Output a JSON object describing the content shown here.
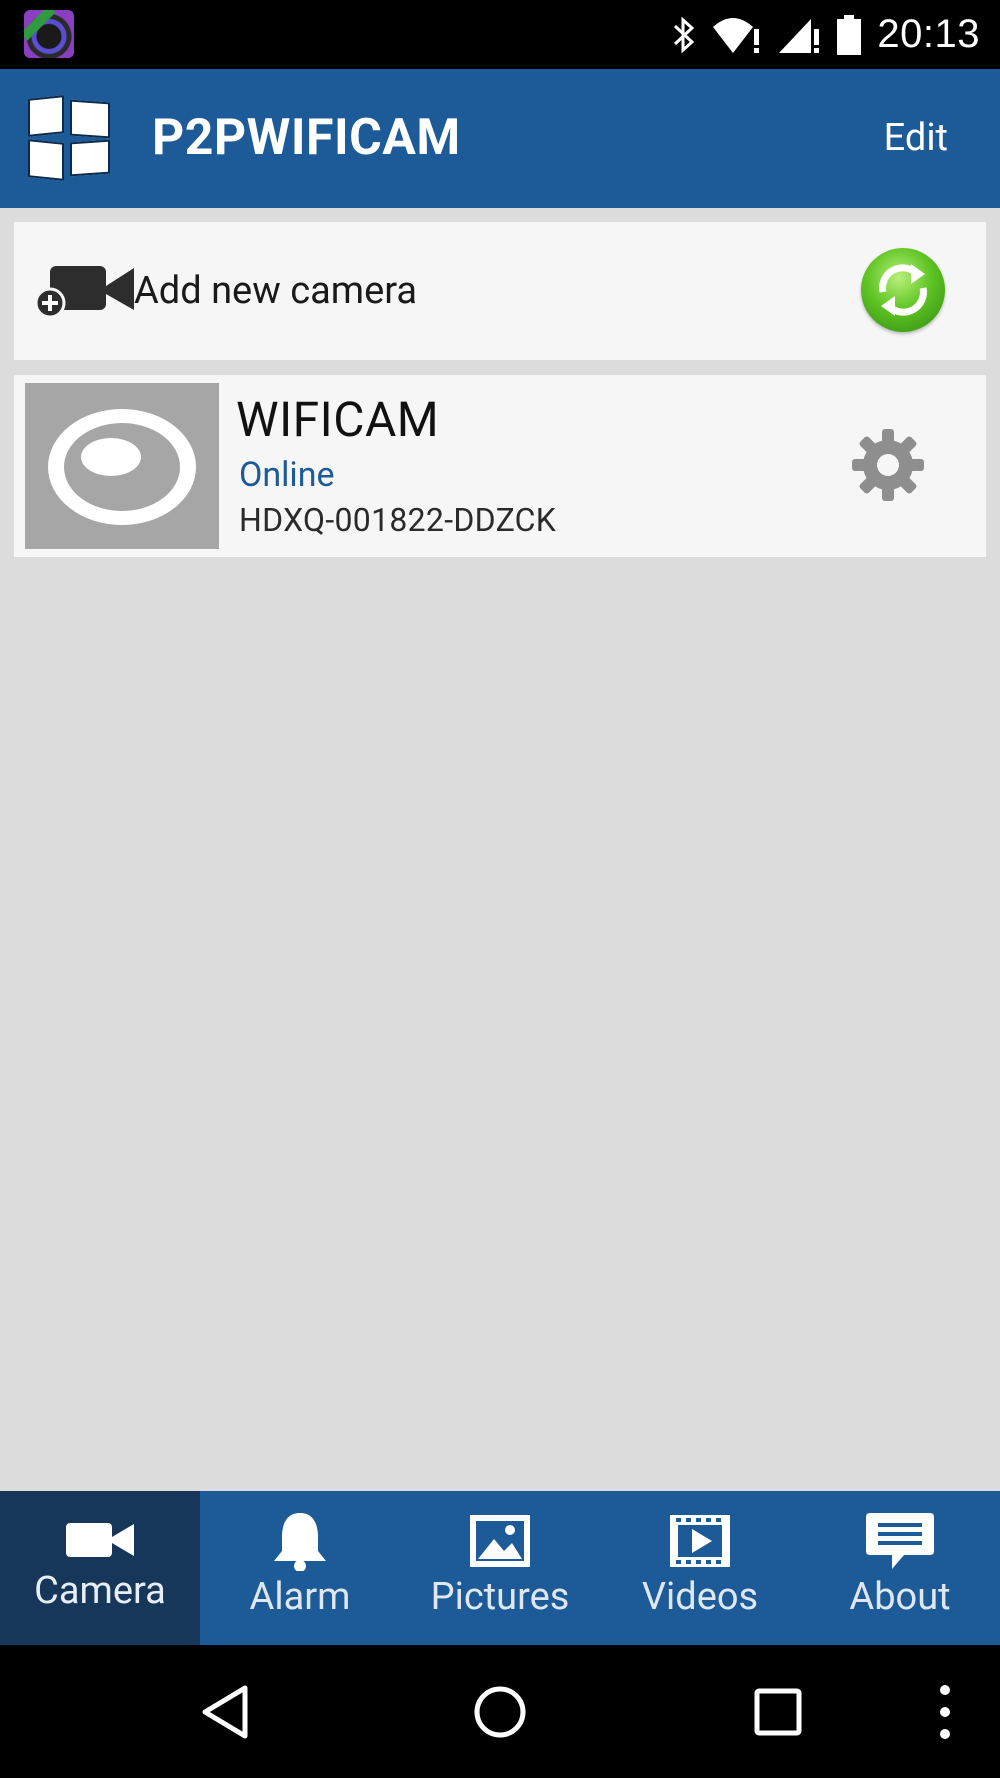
{
  "status_bar": {
    "time": "20:13",
    "icons": [
      "app-notification-icon",
      "bluetooth-icon",
      "wifi-alert-icon",
      "signal-alert-icon",
      "battery-icon"
    ]
  },
  "app_bar": {
    "title": "P2PWIFICAM",
    "edit_label": "Edit",
    "menu_icon": "grid-menu-icon"
  },
  "add_camera": {
    "label": "Add new camera",
    "icon": "add-camera-icon",
    "refresh_icon": "refresh-icon"
  },
  "cameras": [
    {
      "name": "WIFICAM",
      "status": "Online",
      "uid": "HDXQ-001822-DDZCK",
      "settings_icon": "gear-icon"
    }
  ],
  "bottom_nav": {
    "tabs": [
      {
        "label": "Camera",
        "icon": "video-camera-icon",
        "active": true
      },
      {
        "label": "Alarm",
        "icon": "bell-icon",
        "active": false
      },
      {
        "label": "Pictures",
        "icon": "picture-icon",
        "active": false
      },
      {
        "label": "Videos",
        "icon": "film-icon",
        "active": false
      },
      {
        "label": "About",
        "icon": "message-icon",
        "active": false
      }
    ]
  },
  "system_nav": {
    "buttons": [
      "back-icon",
      "home-icon",
      "recents-icon",
      "overflow-menu-icon"
    ]
  },
  "colors": {
    "primary": "#1c5a98",
    "active_tab": "#17375a",
    "status_online": "#1c5a98",
    "refresh_green": "#5fc424"
  }
}
